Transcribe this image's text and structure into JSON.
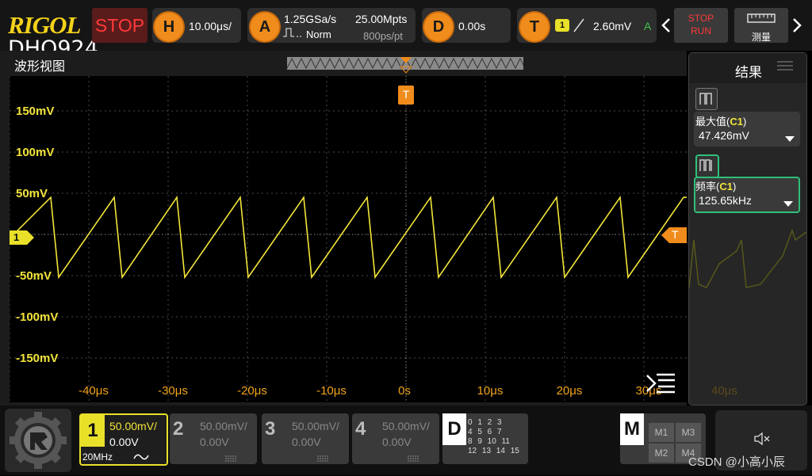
{
  "brand": {
    "logo": "RIGOL",
    "model": "DHO924"
  },
  "run_state": "STOP",
  "horizontal": {
    "icon_letter": "H",
    "timebase": "10.00μs/"
  },
  "acquire": {
    "icon_letter": "A",
    "sample_rate": "1.25GSa/s",
    "mode": "Norm",
    "memory_depth": "25.00Mpts",
    "points_per_div": "800ps/pt"
  },
  "delay": {
    "icon_letter": "D",
    "value": "0.00s"
  },
  "trigger": {
    "icon_letter": "T",
    "source": "1",
    "level": "2.60mV",
    "sweep": "A"
  },
  "nav": {
    "prev_icon": "chevron-left-icon",
    "next_icon": "chevron-right-icon"
  },
  "run_stop_button": {
    "stop": "STOP",
    "run": "RUN"
  },
  "measure_button": {
    "label": "测量"
  },
  "wave_view": {
    "title": "波形视图"
  },
  "y_axis": {
    "unit": "V",
    "ticks": [
      "150mV",
      "100mV",
      "50mV",
      "-50mV",
      "-100mV",
      "-150mV"
    ]
  },
  "x_axis": {
    "ticks": [
      "-40μs",
      "-30μs",
      "-20μs",
      "-10μs",
      "0s",
      "10μs",
      "20μs",
      "30μs",
      "40μs"
    ]
  },
  "markers": {
    "channel": "1",
    "trigger": "T"
  },
  "results": {
    "title": "结果",
    "items": [
      {
        "name_prefix": "最大值(",
        "channel": "C1",
        "name_suffix": ")",
        "value": "47.426mV"
      },
      {
        "name_prefix": "频率(",
        "channel": "C1",
        "name_suffix": ")",
        "value": "125.65kHz"
      }
    ]
  },
  "chart_data": {
    "type": "line",
    "title": "",
    "xlabel": "",
    "ylabel": "",
    "x_unit": "μs",
    "y_unit": "mV",
    "xlim": [
      -50,
      50
    ],
    "ylim": [
      -200,
      200
    ],
    "grid": true,
    "series": [
      {
        "x": [
          -44.8,
          -43.8,
          -36.8,
          -35.8,
          -28.9,
          -27.9,
          -20.9,
          -19.9,
          -12.9,
          -11.9,
          -4.9,
          -3.9,
          3.1,
          4.1,
          11.0,
          12.0,
          19.0,
          20.0,
          27.0,
          28.0,
          35.0
        ],
        "y": [
          45,
          -52,
          45,
          -52,
          45,
          -52,
          45,
          -52,
          45,
          -52,
          45,
          -52,
          45,
          -52,
          45,
          -52,
          45,
          -52,
          45,
          -52,
          45
        ]
      }
    ],
    "color": "#f2e43a"
  },
  "channels": [
    {
      "num": "1",
      "scale": "50.00mV/",
      "offset": "0.00V",
      "bw": "20MHz",
      "active": true
    },
    {
      "num": "2",
      "scale": "50.00mV/",
      "offset": "0.00V",
      "active": false
    },
    {
      "num": "3",
      "scale": "50.00mV/",
      "offset": "0.00V",
      "active": false
    },
    {
      "num": "4",
      "scale": "50.00mV/",
      "offset": "0.00V",
      "active": false
    }
  ],
  "digital": {
    "label": "D",
    "rows": [
      "0 1 2 3",
      "4 5 6 7",
      "8 9 10 11",
      "12 13 14 15"
    ]
  },
  "math": {
    "label": "M",
    "items": [
      "M1",
      "M3",
      "M2",
      "M4"
    ]
  },
  "watermark": "CSDN @小高小辰"
}
